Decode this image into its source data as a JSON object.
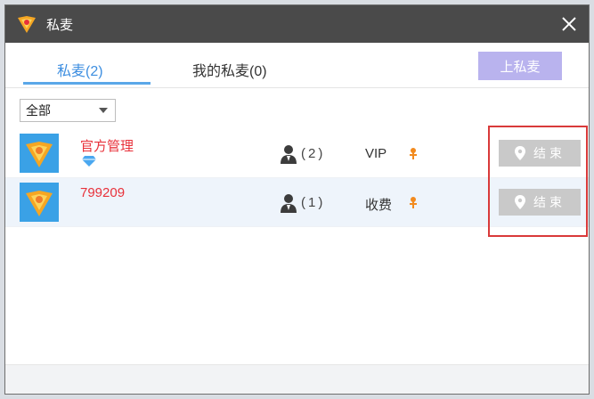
{
  "window": {
    "title": "私麦"
  },
  "tabs": [
    {
      "label": "私麦(2)",
      "active": true
    },
    {
      "label": "我的私麦(0)",
      "active": false
    }
  ],
  "toolbar": {
    "go_private_mic_label": "上私麦"
  },
  "filter": {
    "selected": "全部"
  },
  "rows": [
    {
      "name": "官方管理",
      "badge": "diamond-icon",
      "count": "(2)",
      "level": "VIP",
      "end_label": "结束"
    },
    {
      "name": "799209",
      "badge": "",
      "count": "(1)",
      "level": "收费",
      "end_label": "结束"
    }
  ],
  "colors": {
    "titlebar": "#4a4a4a",
    "accent": "#3d8ee0",
    "name_red": "#e8313a",
    "button_purple": "#b9b3ee",
    "end_button": "#c9c9c9",
    "highlight": "#d93a3a"
  }
}
